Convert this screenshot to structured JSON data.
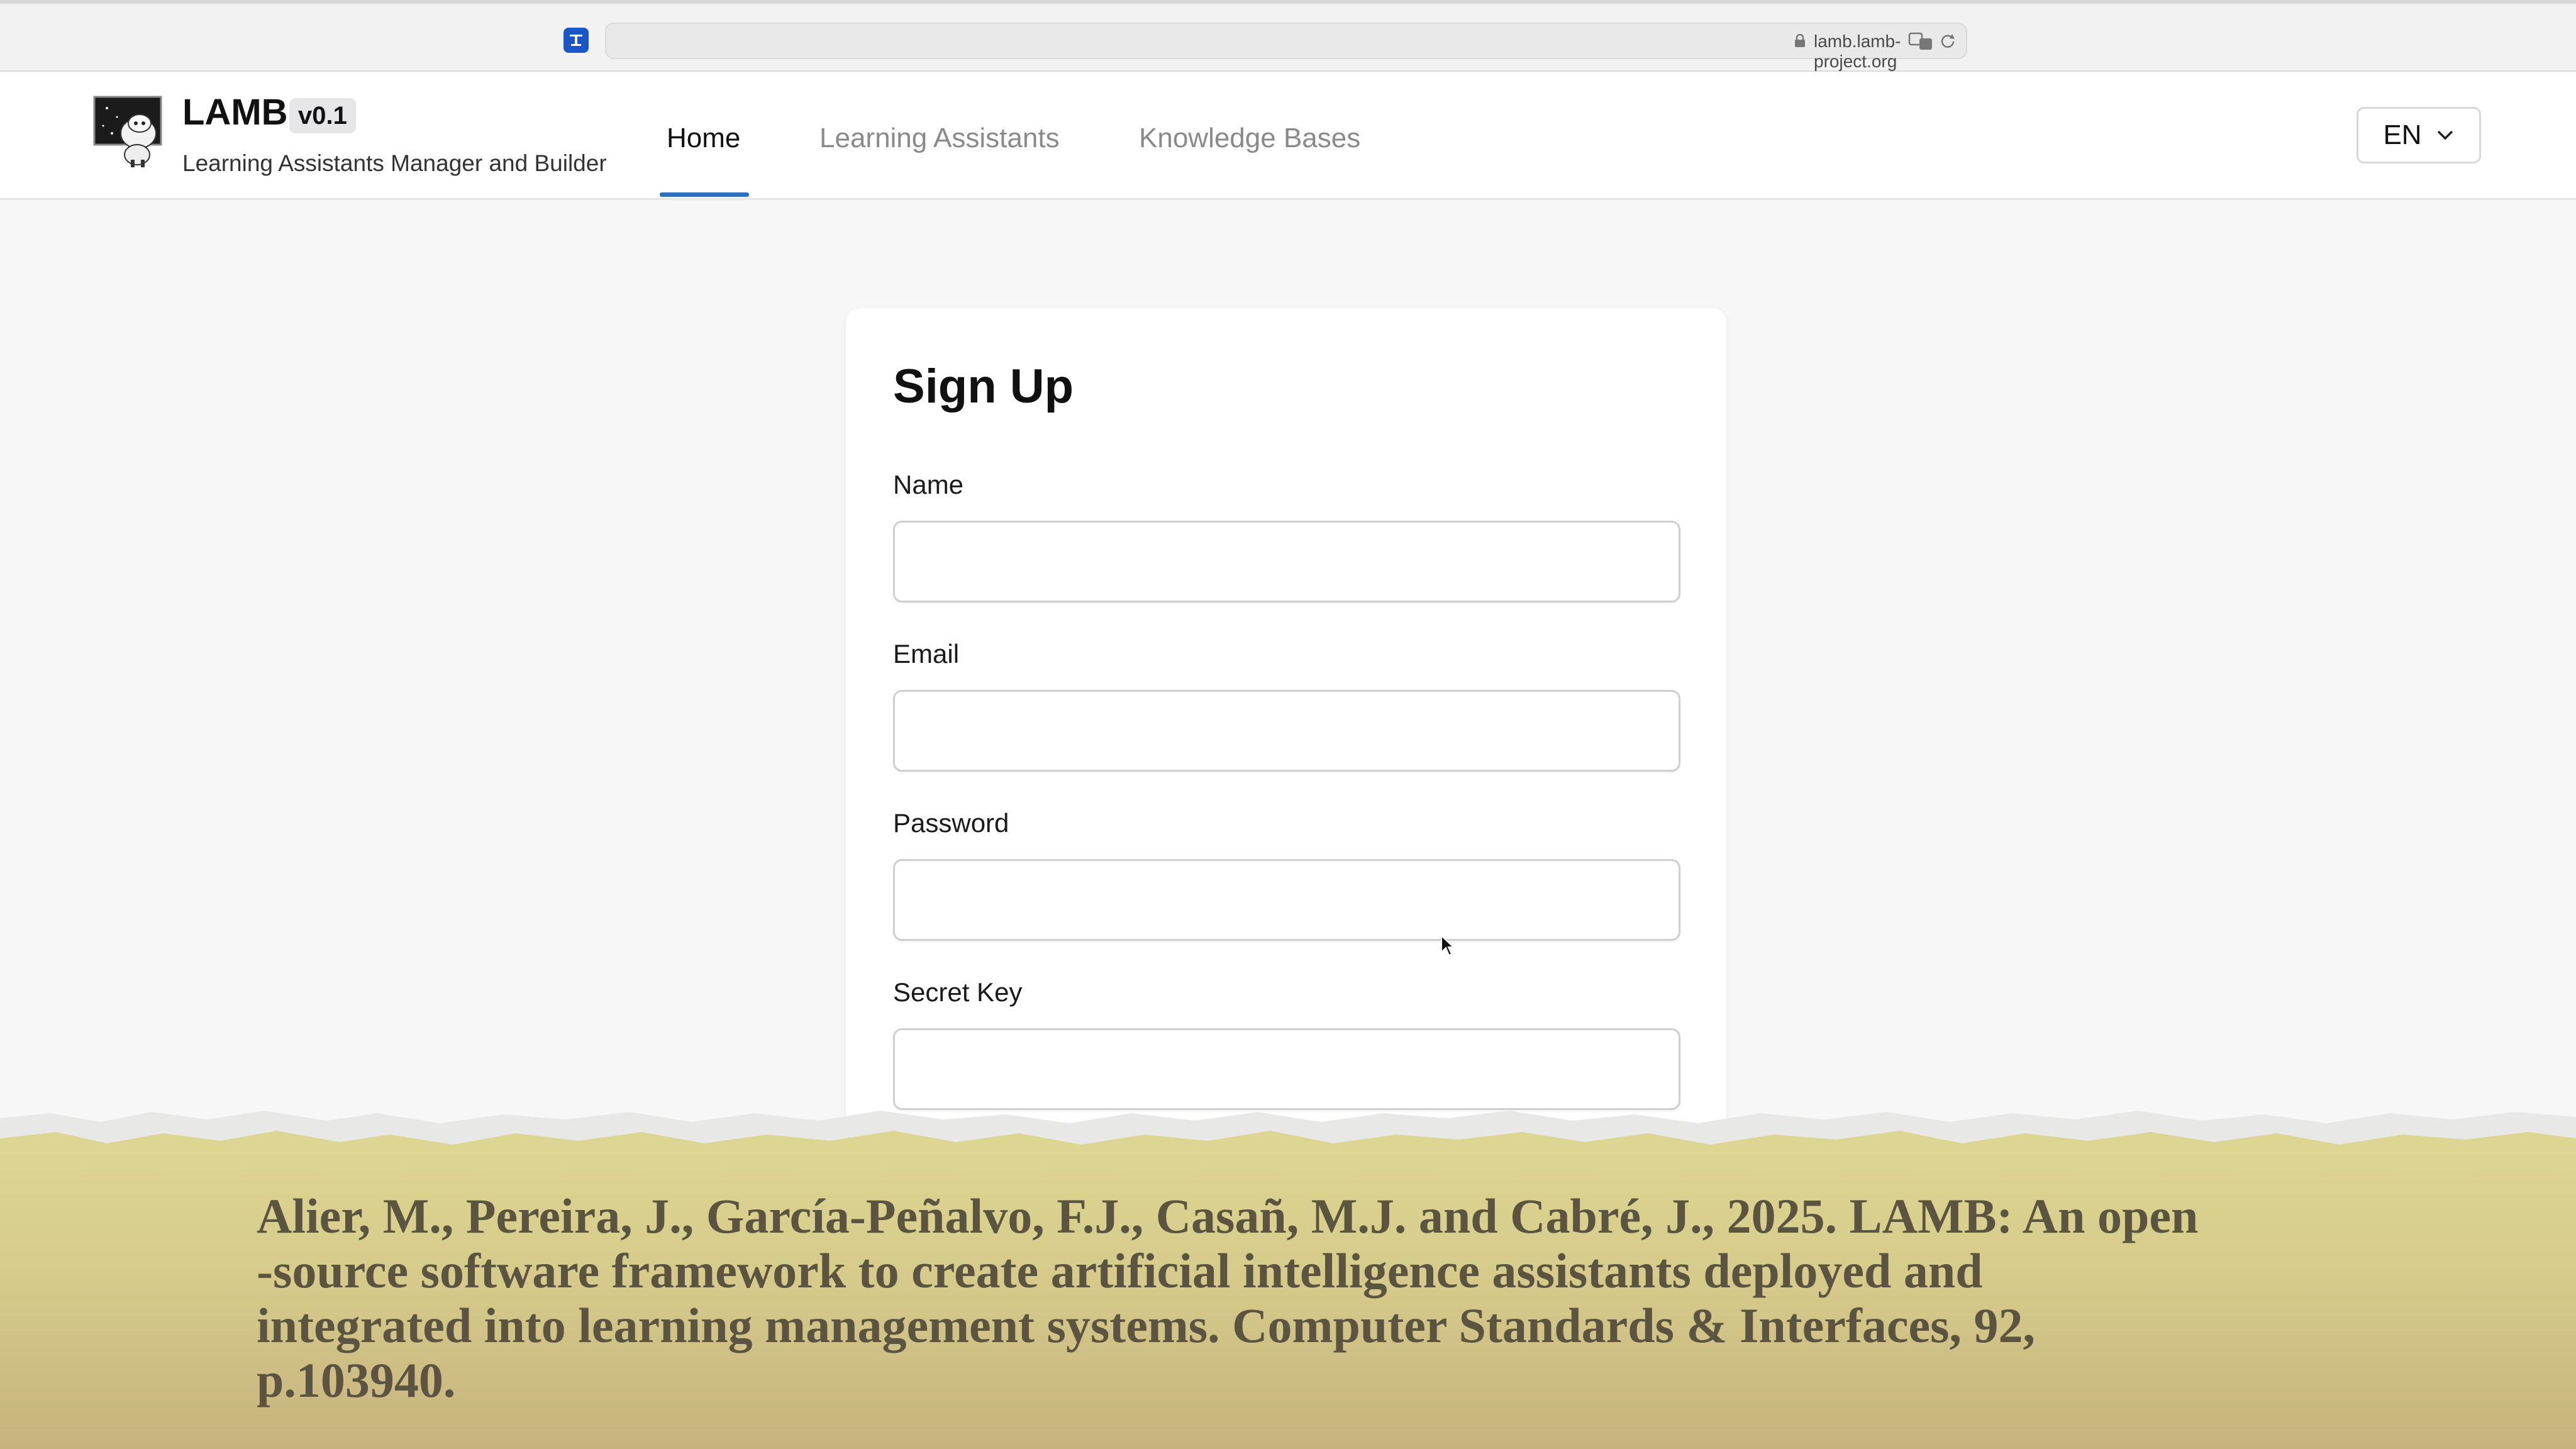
{
  "browser": {
    "url": "lamb.lamb-project.org"
  },
  "header": {
    "brand": "LAMB",
    "version": "v0.1",
    "subtitle": "Learning Assistants Manager and Builder",
    "nav": [
      {
        "label": "Home",
        "active": true
      },
      {
        "label": "Learning Assistants",
        "active": false
      },
      {
        "label": "Knowledge Bases",
        "active": false
      }
    ],
    "language": "EN"
  },
  "signup": {
    "title": "Sign Up",
    "fields": [
      {
        "label": "Name",
        "value": ""
      },
      {
        "label": "Email",
        "value": ""
      },
      {
        "label": "Password",
        "value": ""
      },
      {
        "label": "Secret Key",
        "value": ""
      }
    ]
  },
  "citation": {
    "text": "Alier, M., Pereira, J., García-Peñalvo, F.J., Casañ, M.J. and Cabré, J., 2025. LAMB: An open\n-source software framework to create artificial intelligence assistants deployed and\nintegrated into learning management systems. Computer Standards & Interfaces, 92,\np.103940."
  },
  "colors": {
    "accent": "#2f6fbf",
    "page_bg": "#f7f7f8",
    "citation_text": "#5b5440"
  }
}
